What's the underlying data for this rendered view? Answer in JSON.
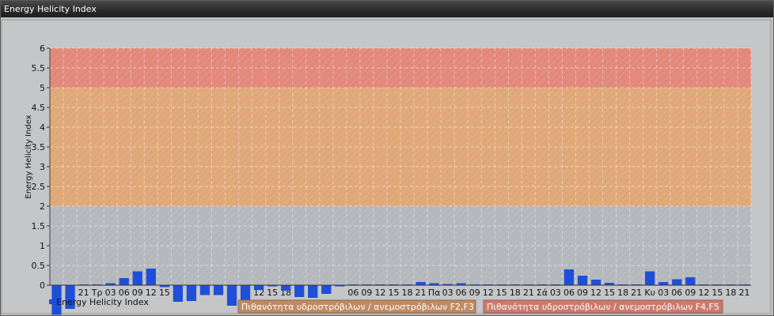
{
  "window": {
    "title": "Energy Helicity Index"
  },
  "chart_data": {
    "type": "bar",
    "ylabel": "Energy Helicity Index",
    "ylim": [
      -0.8,
      6
    ],
    "yticks": [
      "0",
      "0.5",
      "1",
      "1.5",
      "2",
      "2.5",
      "3",
      "3.5",
      "4",
      "4.5",
      "5",
      "5.5",
      "6"
    ],
    "bands": [
      {
        "from": 0,
        "to": 2,
        "color": "#b4b8bc"
      },
      {
        "from": 2,
        "to": 5,
        "color": "#e0a878"
      },
      {
        "from": 5,
        "to": 6,
        "color": "#e2887a"
      }
    ],
    "categories": [
      "",
      "",
      "21",
      "Τρ",
      "03",
      "06",
      "09",
      "12",
      "15",
      "",
      "",
      "",
      "",
      "",
      "",
      "12",
      "15",
      "18",
      "",
      "",
      "",
      "",
      "06",
      "09",
      "12",
      "15",
      "18",
      "21",
      "Πα",
      "03",
      "06",
      "09",
      "12",
      "15",
      "18",
      "21",
      "Σά",
      "03",
      "06",
      "09",
      "12",
      "15",
      "18",
      "21",
      "Κυ",
      "03",
      "06",
      "09",
      "12",
      "15",
      "18",
      "21"
    ],
    "series": [
      {
        "color": "#1f4fd6",
        "values": [
          -0.75,
          -0.6,
          0.02,
          0.02,
          0.05,
          0.18,
          0.35,
          0.42,
          -0.05,
          -0.42,
          -0.4,
          -0.25,
          -0.25,
          -0.52,
          -0.38,
          -0.12,
          -0.03,
          -0.14,
          -0.3,
          -0.32,
          -0.22,
          -0.03,
          0.02,
          0.02,
          0.02,
          0.02,
          0.02,
          0.08,
          0.05,
          0.03,
          0.05,
          0.02,
          0.02,
          0.02,
          0.02,
          0.02,
          0.02,
          0.02,
          0.4,
          0.24,
          0.14,
          0.06,
          0.02,
          0.02,
          0.35,
          0.08,
          0.15,
          0.2,
          0.02,
          0.02,
          0.02,
          0.02
        ]
      }
    ],
    "legend": [
      {
        "label": "Energy Helicity Index",
        "color": "#1f4fd6"
      },
      {
        "label": "Πιθανότητα υδροστρόβιλων / ανεμοστρόβιλων F2,F3",
        "color": "#c08a62"
      },
      {
        "label": "Πιθανότητα υδροστρόβιλων / ανεμοστρόβιλων F4,F5",
        "color": "#cc7a6c"
      }
    ]
  }
}
